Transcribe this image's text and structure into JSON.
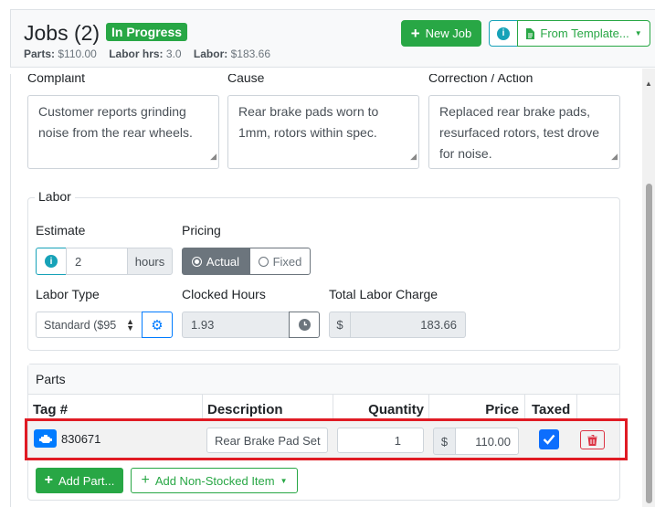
{
  "header": {
    "title": "Jobs (2)",
    "status_badge": "In Progress",
    "parts_label": "Parts:",
    "parts_value": "$110.00",
    "labor_hrs_label": "Labor hrs:",
    "labor_hrs_value": "3.0",
    "labor_label": "Labor:",
    "labor_value": "$183.66",
    "new_job_label": "New Job",
    "from_template_label": "From Template..."
  },
  "notes": {
    "complaint_label": "Complaint",
    "cause_label": "Cause",
    "correction_label": "Correction / Action",
    "complaint_text": "Customer reports grinding noise from the rear wheels.",
    "cause_text": "Rear brake pads worn to 1mm, rotors within spec.",
    "correction_text": "Replaced rear brake pads, resurfaced rotors, test drove for noise."
  },
  "labor": {
    "legend": "Labor",
    "estimate_label": "Estimate",
    "estimate_value": "2",
    "estimate_unit": "hours",
    "pricing_label": "Pricing",
    "pricing_options": [
      "Actual",
      "Fixed"
    ],
    "pricing_selected": "Actual",
    "labor_type_label": "Labor Type",
    "labor_type_value": "Standard ($95",
    "clocked_hours_label": "Clocked Hours",
    "clocked_hours_value": "1.93",
    "total_charge_label": "Total Labor Charge",
    "currency_symbol": "$",
    "total_charge_value": "183.66"
  },
  "parts": {
    "title": "Parts",
    "columns": [
      "Tag #",
      "Description",
      "Quantity",
      "Price",
      "Taxed"
    ],
    "rows": [
      {
        "tag": "830671",
        "description": "Rear Brake Pad Set",
        "quantity": "1",
        "currency": "$",
        "price": "110.00",
        "taxed": true
      }
    ],
    "add_part_label": "Add Part...",
    "add_non_stocked_label": "Add Non-Stocked Item"
  },
  "colors": {
    "success": "#28a745",
    "info": "#17a2b8",
    "primary": "#007bff",
    "danger": "#dc3545",
    "highlight": "#e01b24"
  }
}
